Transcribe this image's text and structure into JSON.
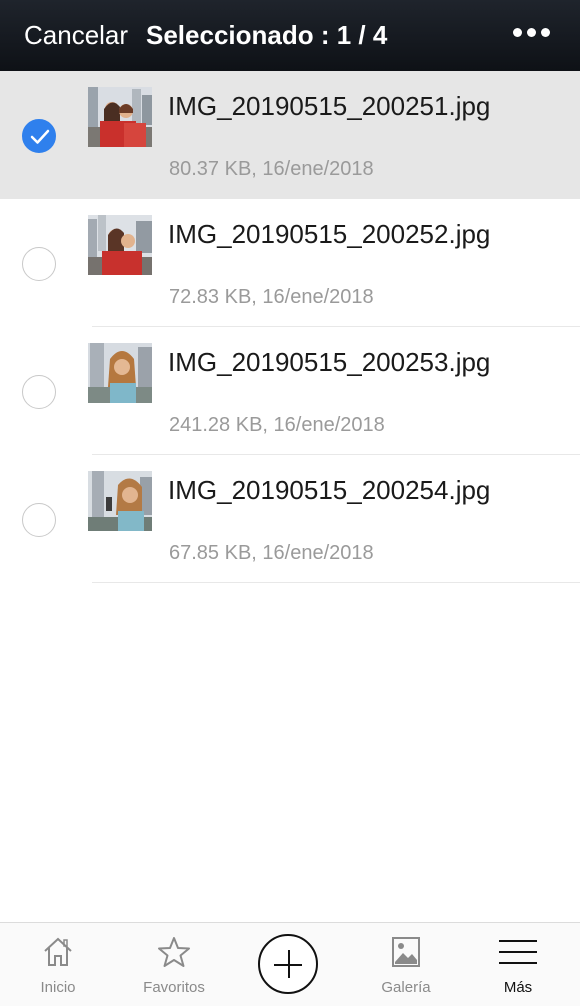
{
  "header": {
    "cancel_label": "Cancelar",
    "title": "Seleccionado : 1 / 4",
    "more_icon": "more-horizontal-icon"
  },
  "files": [
    {
      "name": "IMG_20190515_200251.jpg",
      "meta": "80.37 KB, 16/ene/2018",
      "selected": true
    },
    {
      "name": "IMG_20190515_200252.jpg",
      "meta": "72.83 KB, 16/ene/2018",
      "selected": false
    },
    {
      "name": "IMG_20190515_200253.jpg",
      "meta": "241.28 KB, 16/ene/2018",
      "selected": false
    },
    {
      "name": "IMG_20190515_200254.jpg",
      "meta": "67.85 KB, 16/ene/2018",
      "selected": false
    }
  ],
  "tabbar": {
    "tabs": [
      {
        "label": "Inicio",
        "icon": "home-icon"
      },
      {
        "label": "Favoritos",
        "icon": "star-icon"
      },
      {
        "label": "",
        "icon": "plus-circle-icon"
      },
      {
        "label": "Galería",
        "icon": "image-icon"
      },
      {
        "label": "Más",
        "icon": "menu-icon",
        "active": true
      }
    ]
  },
  "colors": {
    "header_bg": "#12161c",
    "accent": "#2f80ed",
    "selected_row": "#e6e6e6"
  }
}
